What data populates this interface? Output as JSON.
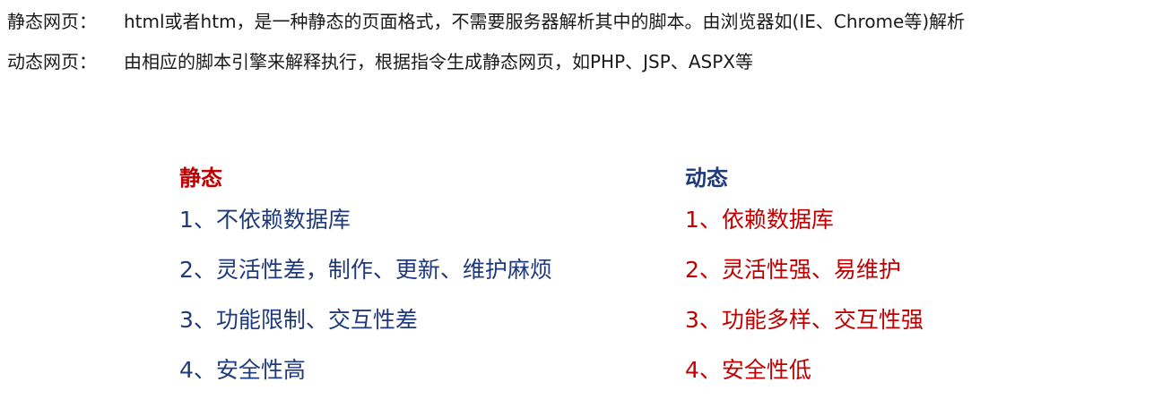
{
  "definitions": [
    {
      "term": "静态网页：",
      "description": "html或者htm，是一种静态的页面格式，不需要服务器解析其中的脚本。由浏览器如(IE、Chrome等)解析"
    },
    {
      "term": "动态网页：",
      "description": "由相应的脚本引擎来解释执行，根据指令生成静态网页，如PHP、JSP、ASPX等"
    }
  ],
  "comparison": {
    "static": {
      "title": "静态",
      "items": [
        "1、不依赖数据库",
        "2、灵活性差，制作、更新、维护麻烦",
        "3、功能限制、交互性差",
        "4、安全性高"
      ]
    },
    "dynamic": {
      "title": "动态",
      "items": [
        "1、依赖数据库",
        "2、灵活性强、易维护",
        "3、功能多样、交互性强",
        "4、安全性低"
      ]
    }
  },
  "colors": {
    "red": "#c00000",
    "navy": "#1f3a7a",
    "text": "#1a1a1a"
  }
}
